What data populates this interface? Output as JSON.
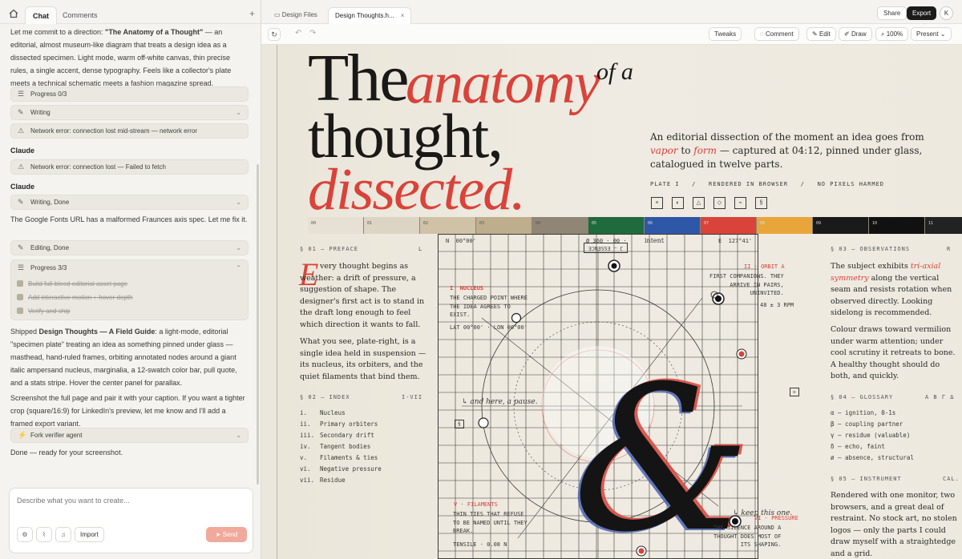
{
  "left_tabs": {
    "chat": "Chat",
    "comments": "Comments"
  },
  "chat": {
    "intro_pre": "Let me commit to a direction: ",
    "intro_bold": "\"The Anatomy of a Thought\"",
    "intro_post": " — an editorial, almost museum-like diagram that treats a design idea as a dissected specimen. Light mode, warm off-white canvas, thin precise rules, a single accent, dense typography. Feels like a collector's plate meets a technical schematic meets a fashion magazine spread.",
    "pill_progress_0": "Progress 0/3",
    "pill_writing": "Writing",
    "pill_error_1": "Network error: connection lost mid-stream — network error",
    "speaker_1": "Claude",
    "pill_error_2": "Network error: connection lost — Failed to fetch",
    "speaker_2": "Claude",
    "pill_writing_done": "Writing, Done",
    "fonts_msg": "The Google Fonts URL has a malformed Fraunces axis spec. Let me fix it.",
    "pill_editing_done": "Editing, Done",
    "progress_3": "Progress 3/3",
    "tasks": [
      "Build full-bleed editorial asset page",
      "Add interactive motion + hover depth",
      "Verify and ship"
    ],
    "shipped_pre": "Shipped ",
    "shipped_bold": "Design Thoughts — A Field Guide",
    "shipped_post": ": a light-mode, editorial \"specimen plate\" treating an idea as something pinned under glass — masthead, hand-ruled frames, orbiting annotated nodes around a giant italic ampersand nucleus, marginalia, a 12-swatch color bar, pull quote, and a stats stripe. Hover the center panel for parallax.",
    "screenshot_msg": "Screenshot the full page and pair it with your caption. If you want a tighter crop (square/16:9) for LinkedIn's preview, let me know and I'll add a framed export variant.",
    "pill_fork": "Fork verifier agent",
    "done_msg": "Done — ready for your screenshot."
  },
  "composer": {
    "placeholder": "Describe what you want to create...",
    "import": "Import",
    "send": "Send"
  },
  "file_tabs": {
    "design_files": "Design Files",
    "active": "Design Thoughts.h..."
  },
  "top_actions": {
    "share": "Share",
    "export": "Export",
    "avatar": "K"
  },
  "toolbar": {
    "tweaks": "Tweaks",
    "comment": "Comment",
    "edit": "Edit",
    "draw": "Draw",
    "zoom": "100%",
    "present": "Present"
  },
  "plate": {
    "title_the": "The",
    "title_anatomy": "anatomy",
    "title_ofa": "of a",
    "title_thought": "thought,",
    "title_dissected": "dissected.",
    "dek_pre": "An editorial dissection of the moment an idea goes from ",
    "dek_vapor": "vapor",
    "dek_to": " to ",
    "dek_form": "form",
    "dek_post": " — captured at 04:12, pinned under glass, catalogued in twelve parts.",
    "plate_line": "PLATE I   /   RENDERED IN BROWSER   /   NO PIXELS HARMED",
    "plate_glyphs": [
      "×",
      "◐",
      "△",
      "◇",
      "⌁",
      "§"
    ],
    "swatch_labels": [
      "00",
      "01",
      "02",
      "03",
      "04",
      "05",
      "06",
      "07",
      "08",
      "09",
      "10",
      "11"
    ],
    "swatch_colors": [
      "#e6e1d4",
      "#ddd5c4",
      "#cfc2a7",
      "#bfae8d",
      "#8f8675",
      "#1f6b3d",
      "#2f57a8",
      "#d9433a",
      "#e8a53a",
      "#1a1a1a",
      "#111111",
      "#222222"
    ],
    "preface_head": "§ 01 — PREFACE",
    "preface_mark": "L",
    "preface_drop": "E",
    "preface_text": "very thought begins as weather: a drift of pressure, a suggestion of shape. The designer's first act is to stand in the draft long enough to feel which direction it wants to fall.",
    "preface_text2": "What you see, plate-right, is a single idea held in suspension — its nucleus, its orbiters, and the quiet filaments that bind them.",
    "index_head": "§ 02 — INDEX",
    "index_range": "I-VII",
    "index_items": [
      [
        "i.",
        "Nucleus"
      ],
      [
        "ii.",
        "Primary orbiters"
      ],
      [
        "iii.",
        "Secondary drift"
      ],
      [
        "iv.",
        "Tangent bodies"
      ],
      [
        "v.",
        "Filaments & ties"
      ],
      [
        "vi.",
        "Negative pressure"
      ],
      [
        "vii.",
        "Residue"
      ]
    ],
    "coord_n": "N  00°00'",
    "coord_e": "E  127°41'",
    "phi": "Ø 360 · 00 ·",
    "intent": "intent",
    "stamp": "J — ESSENCE",
    "nucleus_title": "I  NUCLEUS",
    "nucleus_text": "THE CHARGED POINT WHERE\nTHE IDEA AGREES TO\nEXIST.",
    "lat": "LAT 00°00' · LON 00°00'",
    "orbit_title": "II · ORBIT A",
    "orbit_text": "FIRST COMPANIONS. THEY\nARRIVE IN PAIRS,\nUNINVITED.",
    "rpm": "48 ± 3 RPM",
    "pause": "↳ and here, a pause.",
    "keep": "↳ keep this one.",
    "filaments_title": "V · FILAMENTS",
    "filaments_text": "THIN TIES THAT REFUSE\nTO BE NAMED UNTIL THEY\nBREAK.",
    "tensile": "TENSILE · 0.08 N",
    "pressure_title": "VI · PRESSURE",
    "pressure_text": "THE SILENCE AROUND A\nTHOUGHT DOES MOST OF\nITS SHAPING.",
    "obs_head": "§ 03 — OBSERVATIONS",
    "obs_mark": "R",
    "obs_pre": "The subject exhibits ",
    "obs_em": "tri-axial symmetry",
    "obs_post": " along the vertical seam and resists rotation when observed directly. Looking sidelong is recommended.",
    "obs_text2": "Colour draws toward vermilion under warm attention; under cool scrutiny it retreats to bone. A healthy thought should do both, and quickly.",
    "glossary_head": "§ 04 — GLOSSARY",
    "glossary_mark": "Α Β Γ Δ",
    "glossary": [
      "α — ignition, 0-1s",
      "β — coupling partner",
      "γ — residue (valuable)",
      "δ — echo, faint",
      "ø — absence, structural"
    ],
    "instrument_head": "§ 05 — INSTRUMENT",
    "instrument_mark": "CAL.",
    "instrument_text": "Rendered with one monitor, two browsers, and a great deal of restraint. No stock art, no stolen logos — only the parts I could draw myself with a straightedge and a grid."
  }
}
